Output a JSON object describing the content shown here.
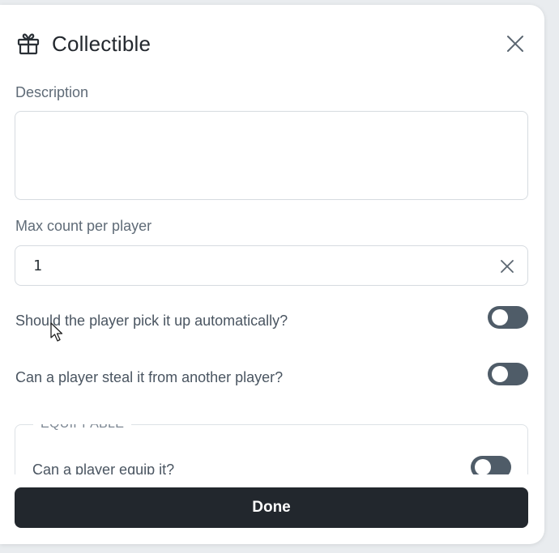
{
  "dialog": {
    "title": "Collectible",
    "title_icon": "gift-icon",
    "close_icon": "close-icon"
  },
  "fields": {
    "description_label": "Description",
    "description_value": "",
    "max_count_label": "Max count per player",
    "max_count_value": "1"
  },
  "toggles": {
    "auto_pickup_label": "Should the player pick it up automatically?",
    "auto_pickup_on": false,
    "steal_label": "Can a player steal it from another player?",
    "steal_on": false
  },
  "equippable": {
    "legend": "EQUIPPABLE",
    "equip_label": "Can a player equip it?",
    "equip_on": false
  },
  "footer": {
    "done_label": "Done"
  },
  "colors": {
    "toggle_off": "#4f5c68",
    "primary_button": "#22272d",
    "text": "#4a5561"
  }
}
